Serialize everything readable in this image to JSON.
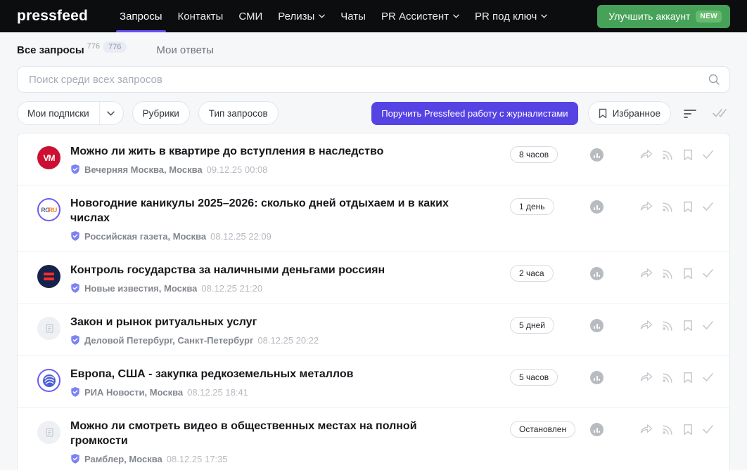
{
  "nav": {
    "logo": "pressfeed",
    "items": [
      {
        "label": "Запросы",
        "active": true,
        "chevron": false
      },
      {
        "label": "Контакты",
        "active": false,
        "chevron": false
      },
      {
        "label": "СМИ",
        "active": false,
        "chevron": false
      },
      {
        "label": "Релизы",
        "active": false,
        "chevron": true
      },
      {
        "label": "Чаты",
        "active": false,
        "chevron": false
      },
      {
        "label": "PR Ассистент",
        "active": false,
        "chevron": true
      },
      {
        "label": "PR под ключ",
        "active": false,
        "chevron": true
      }
    ],
    "upgrade_button": {
      "label": "Улучшить аккаунт",
      "badge": "NEW"
    }
  },
  "tabs": {
    "all_requests": {
      "label": "Все запросы",
      "count_sup": "776",
      "count_badge": "776"
    },
    "my_answers": {
      "label": "Мои ответы"
    }
  },
  "search": {
    "placeholder": "Поиск среди всех запросов"
  },
  "filters": {
    "subscriptions_label": "Мои подписки",
    "rubrics_label": "Рубрики",
    "request_types_label": "Тип запросов",
    "hire_button_label": "Поручить Pressfeed работу с журналистами",
    "favorites_label": "Избранное"
  },
  "requests": [
    {
      "title": "Можно ли жить в квартире до вступления в наследство",
      "source": "Вечерняя Москва, Москва",
      "datetime": "09.12.25 00:08",
      "time_left": "8 часов",
      "avatar": {
        "kind": "text",
        "text": "VM",
        "bg": "#cb1033"
      }
    },
    {
      "title": "Новогодние каникулы 2025–2026: сколько дней отдыхаем и в каких числах",
      "source": "Российская газета, Москва",
      "datetime": "08.12.25 22:09",
      "time_left": "1 день",
      "avatar": {
        "kind": "rgru",
        "part1": "RG",
        "part2": "RU"
      }
    },
    {
      "title": "Контроль государства за наличными деньгами россиян",
      "source": "Новые известия, Москва",
      "datetime": "08.12.25 21:20",
      "time_left": "2 часа",
      "avatar": {
        "kind": "equals",
        "bg": "#16224a",
        "bar_color": "#ff2d23"
      }
    },
    {
      "title": "Закон и рынок ритуальных услуг",
      "source": "Деловой Петербург, Санкт-Петербург",
      "datetime": "08.12.25 20:22",
      "time_left": "5 дней",
      "avatar": {
        "kind": "document"
      }
    },
    {
      "title": "Европа, США - закупка редкоземельных металлов",
      "source": "РИА Новости, Москва",
      "datetime": "08.12.25 18:41",
      "time_left": "5 часов",
      "avatar": {
        "kind": "globe"
      }
    },
    {
      "title": "Можно ли смотреть видео в общественных местах на полной громкости",
      "source": "Рамблер, Москва",
      "datetime": "08.12.25 17:35",
      "time_left": "Остановлен",
      "avatar": {
        "kind": "document"
      }
    }
  ],
  "colors": {
    "topbar_bg": "#0c0d0f",
    "accent_purple": "#5643e4",
    "nav_underline": "#6c4df2",
    "upgrade_green": "#46a258",
    "new_badge_green": "#67bb6f",
    "verified_shield": "#7c82f3",
    "icon_gray": "#c6cacf",
    "page_bg": "#f6f7f9"
  }
}
